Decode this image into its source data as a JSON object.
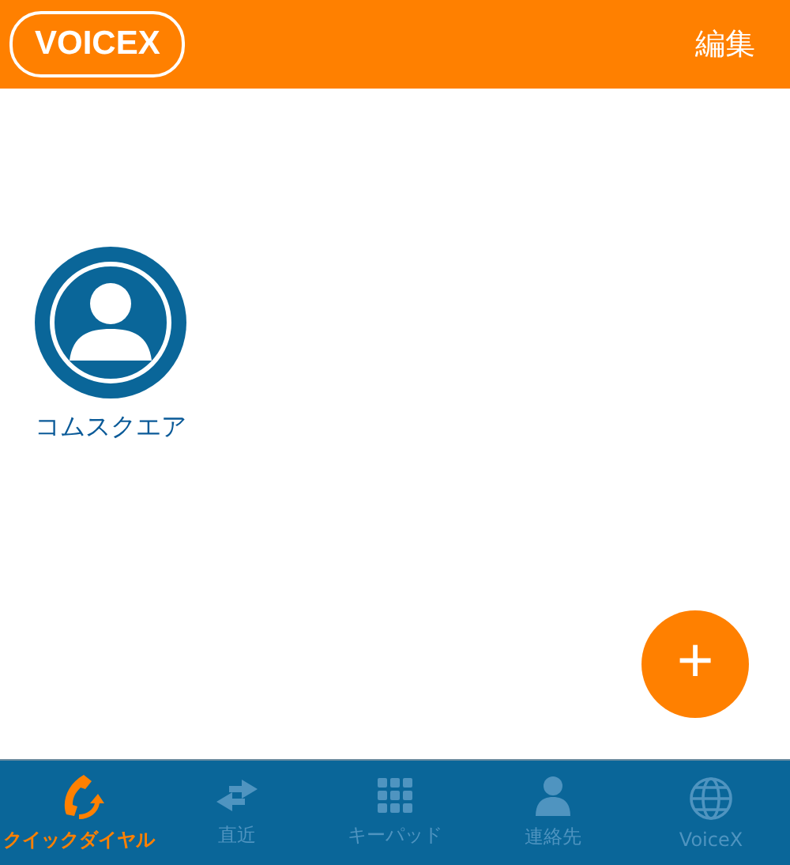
{
  "header": {
    "logo": "VOICEX",
    "action": "編集"
  },
  "quick_dials": [
    {
      "name": "コムスクエア"
    }
  ],
  "fab": {
    "label": "+"
  },
  "tabs": [
    {
      "kind": "quickdial",
      "label": "クイックダイヤル",
      "selected": true
    },
    {
      "kind": "recent",
      "label": "直近",
      "selected": false
    },
    {
      "kind": "keypad",
      "label": "キーパッド",
      "selected": false
    },
    {
      "kind": "contacts",
      "label": "連絡先",
      "selected": false
    },
    {
      "kind": "globe",
      "label": "VoiceX",
      "selected": false
    }
  ]
}
